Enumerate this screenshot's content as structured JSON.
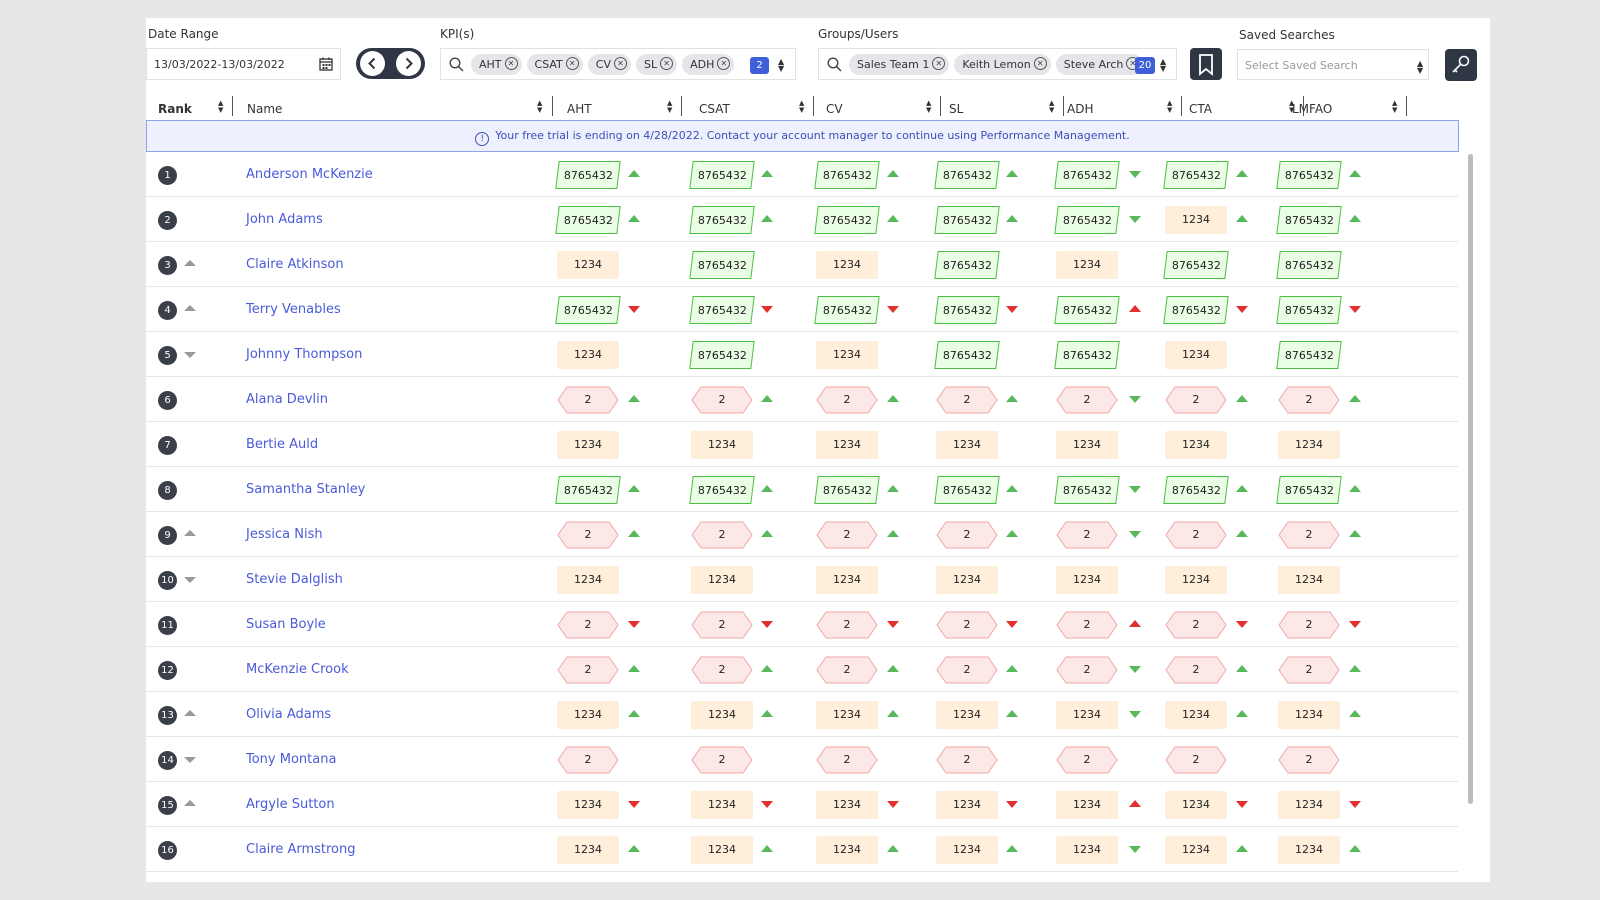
{
  "filters": {
    "date_range_label": "Date Range",
    "date_range_value": "13/03/2022-13/03/2022",
    "kpis_label": "KPI(s)",
    "kpi_chips": [
      "AHT",
      "CSAT",
      "CV",
      "SL",
      "ADH"
    ],
    "kpi_count": "2",
    "groups_label": "Groups/Users",
    "group_chips": [
      "Sales Team 1",
      "Keith Lemon",
      "Steve Arch"
    ],
    "group_count": "20",
    "saved_label": "Saved Searches",
    "saved_placeholder": "Select Saved Search"
  },
  "columns": {
    "rank": "Rank",
    "name": "Name",
    "kpis": [
      "AHT",
      "CSAT",
      "CV",
      "SL",
      "ADH",
      "CTA",
      "LMFAO"
    ]
  },
  "banner": "Your free trial is ending on 4/28/2022. Contact your account manager to continue using Performance Management.",
  "colors": {
    "accent": "#3e5fd8",
    "dark": "#2f3744",
    "good": "#4cbf43",
    "warn": "#feeeda",
    "bad": "#f4a3a3",
    "link": "#4a5bd8"
  },
  "rows": [
    {
      "rank": "1",
      "move": "",
      "name": "Anderson McKenzie",
      "style": "green",
      "value": "8765432",
      "trends": [
        "up",
        "up",
        "up",
        "up",
        "down",
        "up",
        "up"
      ]
    },
    {
      "rank": "2",
      "move": "",
      "name": "John Adams",
      "style": "green",
      "value": "8765432",
      "styles": [
        "green",
        "green",
        "green",
        "green",
        "green",
        "orange",
        "green"
      ],
      "values": [
        "8765432",
        "8765432",
        "8765432",
        "8765432",
        "8765432",
        "1234",
        "8765432"
      ],
      "trends": [
        "up",
        "up",
        "up",
        "up",
        "down",
        "up",
        "up"
      ]
    },
    {
      "rank": "3",
      "move": "up",
      "name": "Claire Atkinson",
      "styles": [
        "orange",
        "green",
        "orange",
        "green",
        "orange",
        "green",
        "green"
      ],
      "values": [
        "1234",
        "8765432",
        "1234",
        "8765432",
        "1234",
        "8765432",
        "8765432"
      ],
      "trends": [
        "",
        "",
        "",
        "",
        "",
        "",
        ""
      ]
    },
    {
      "rank": "4",
      "move": "up",
      "name": "Terry Venables",
      "style": "green",
      "value": "8765432",
      "trends": [
        "downred",
        "downred",
        "downred",
        "downred",
        "upred",
        "downred",
        "downred"
      ]
    },
    {
      "rank": "5",
      "move": "down",
      "name": "Johnny Thompson",
      "styles": [
        "orange",
        "green",
        "orange",
        "green",
        "green",
        "orange",
        "green"
      ],
      "values": [
        "1234",
        "8765432",
        "1234",
        "8765432",
        "8765432",
        "1234",
        "8765432"
      ],
      "trends": [
        "",
        "",
        "",
        "",
        "",
        "",
        ""
      ]
    },
    {
      "rank": "6",
      "move": "",
      "name": "Alana Devlin",
      "style": "red",
      "value": "2",
      "trends": [
        "up",
        "up",
        "up",
        "up",
        "down",
        "up",
        "up"
      ]
    },
    {
      "rank": "7",
      "move": "",
      "name": "Bertie Auld",
      "style": "orange",
      "value": "1234",
      "trends": [
        "",
        "",
        "",
        "",
        "",
        "",
        ""
      ]
    },
    {
      "rank": "8",
      "move": "",
      "name": "Samantha Stanley",
      "style": "green",
      "value": "8765432",
      "trends": [
        "up",
        "up",
        "up",
        "up",
        "down",
        "up",
        "up"
      ]
    },
    {
      "rank": "9",
      "move": "up",
      "name": "Jessica Nish",
      "style": "red",
      "value": "2",
      "trends": [
        "up",
        "up",
        "up",
        "up",
        "down",
        "up",
        "up"
      ]
    },
    {
      "rank": "10",
      "move": "down",
      "name": "Stevie Dalglish",
      "style": "orange",
      "value": "1234",
      "trends": [
        "",
        "",
        "",
        "",
        "",
        "",
        ""
      ]
    },
    {
      "rank": "11",
      "move": "",
      "name": "Susan Boyle",
      "style": "red",
      "value": "2",
      "trends": [
        "downred",
        "downred",
        "downred",
        "downred",
        "upred",
        "downred",
        "downred"
      ]
    },
    {
      "rank": "12",
      "move": "",
      "name": "McKenzie Crook",
      "style": "red",
      "value": "2",
      "trends": [
        "up",
        "up",
        "up",
        "up",
        "down",
        "up",
        "up"
      ]
    },
    {
      "rank": "13",
      "move": "up",
      "name": "Olivia Adams",
      "style": "orange",
      "value": "1234",
      "trends": [
        "up",
        "up",
        "up",
        "up",
        "down",
        "up",
        "up"
      ]
    },
    {
      "rank": "14",
      "move": "down",
      "name": "Tony Montana",
      "style": "red",
      "value": "2",
      "trends": [
        "",
        "",
        "",
        "",
        "",
        "",
        ""
      ]
    },
    {
      "rank": "15",
      "move": "up",
      "name": "Argyle Sutton",
      "style": "orange",
      "value": "1234",
      "trends": [
        "downred",
        "downred",
        "downred",
        "downred",
        "upred",
        "downred",
        "downred"
      ]
    },
    {
      "rank": "16",
      "move": "",
      "name": "Claire Armstrong",
      "style": "orange",
      "value": "1234",
      "trends": [
        "up",
        "up",
        "up",
        "up",
        "down",
        "up",
        "up"
      ]
    }
  ]
}
